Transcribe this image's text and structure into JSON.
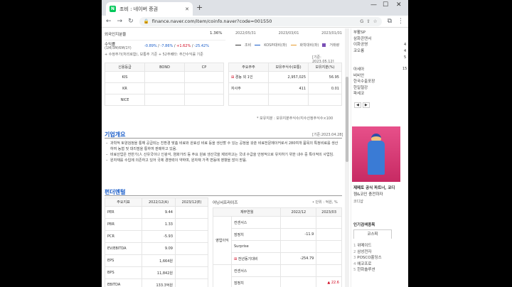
{
  "browser": {
    "tab_title": "조비 : 네이버 증권",
    "url": "finance.naver.com/item/coinfo.naver?code=001550"
  },
  "top": {
    "foreign_label": "외국인지분율",
    "foreign_value": "1.36%",
    "return_label": "수익률",
    "return_sub": "(1M/3M/6M/1Y)",
    "r1": "-0.89%",
    "r2": "-7.86%",
    "r3": "+1.62%",
    "r4": "-25.42%",
    "note": "+ 수정주가(처리로함), 보통주 기준 + 52주베타: 주간수익률 기준",
    "dates": [
      "2022/05/31",
      "2023/03/01",
      "2023/01/01"
    ],
    "legend": [
      "조비",
      "KOSPI대비(좌)",
      "화학대비(좌)",
      "거래량"
    ],
    "base_date": "[기준: 2023.05.12]"
  },
  "rating_table": {
    "headers": [
      "신용등급",
      "BOND",
      "CP"
    ],
    "rows": [
      "KIS",
      "KR",
      "NICE"
    ]
  },
  "holder_table": {
    "headers": [
      "주요주주",
      "보유주식수(보통)",
      "보유지분(%)"
    ],
    "rows": [
      {
        "name": "경농 외 1인",
        "shares": "2,957,025",
        "pct": "56.95"
      },
      {
        "name": "자사주",
        "shares": "411",
        "pct": "0.01"
      },
      {
        "name": "",
        "shares": "",
        "pct": ""
      }
    ],
    "footnote": "* 보유지분 : 보유지분주식수/지수산정주식수×100"
  },
  "overview": {
    "title": "기업개요",
    "base": "[기준:2023.04.28]",
    "items": [
      "과학적 토양검정을 통해 공급되는 친환경 맞춤 비료와 완효성 비료 등을 생산할 수 있는 공정을 갖춘 비료전문메이커로서 280여개 품목의 특정비료를 생산하여 농협 및 대리점을 통하여 판매하고 있음.",
      "비료산업은 전반기(人 산유국이나 인광석, 염화가리 등 주요 원료 생산국을 제외하고는 국내 수급을 안정적으로 유지하기 위한 내수 중 특이적의 사업임.",
      "원자재를 수입에 의존하고 있어 국제 경쟁력이 약하며, 원자재 가격 변동에 영향을 많이 받음."
    ]
  },
  "fundamentals": {
    "title": "펀더멘털",
    "left_headers": [
      "주요지표",
      "2022/12(A)",
      "2023/12(E)"
    ],
    "left_rows": [
      {
        "k": "PER",
        "a": "9.44",
        "e": ""
      },
      {
        "k": "PBR",
        "a": "1.33",
        "e": ""
      },
      {
        "k": "PCR",
        "a": "-5.93",
        "e": ""
      },
      {
        "k": "EV/EBITDA",
        "a": "9.09",
        "e": ""
      },
      {
        "k": "EPS",
        "a": "1,664원",
        "e": ""
      },
      {
        "k": "BPS",
        "a": "11,842원",
        "e": ""
      },
      {
        "k": "EBITDA",
        "a": "133.3억원",
        "e": ""
      }
    ],
    "right_title": "어닝서프라이즈",
    "right_unit": "• 단위 : 억원, %",
    "right_headers": [
      "재무연월",
      "2022/12",
      "2023/03"
    ],
    "right_group": "영업이익",
    "right_rows": [
      {
        "k": "컨센서스",
        "a": "",
        "b": ""
      },
      {
        "k": "잠정치",
        "a": "-11.9",
        "b": ""
      },
      {
        "k": "Surprise",
        "a": "",
        "b": ""
      },
      {
        "k": "전년동기대비",
        "a": "-254.79",
        "b": ""
      },
      {
        "k": "컨센서스",
        "a": "",
        "b": ""
      },
      {
        "k": "잠정치",
        "a": "",
        "b": "▲ 22.6"
      }
    ]
  },
  "sidebar": {
    "top_items": [
      "부활SP",
      "삼화콘덴서",
      "이화공영",
      "코오롱"
    ],
    "nums": [
      "4",
      "4",
      "5"
    ],
    "mid_items": [
      "아세아",
      "비비안",
      "한국수출포장",
      "한일철강",
      "파세코"
    ],
    "mid_num": "15",
    "ad_caption": "제페토 공식 파트너, 코디",
    "ad_sub": "젬&코인 충전하자",
    "ad_brand": "코디샵",
    "rank_title": "인기검색종목",
    "rank_tab": "코스피",
    "ranks": [
      "위메이드",
      "삼성전자",
      "POSCO홀딩스",
      "에코프로",
      "한화솔루션"
    ]
  }
}
